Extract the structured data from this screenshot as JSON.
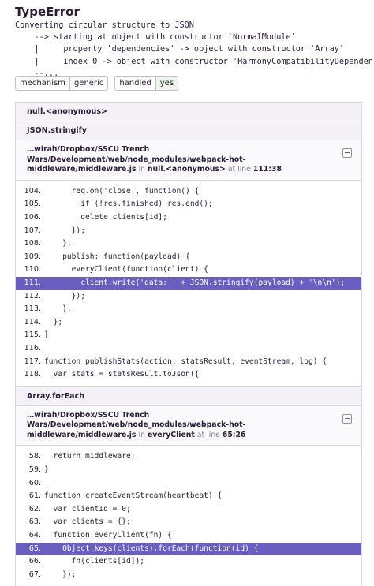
{
  "error": {
    "title": "TypeError",
    "message": "Converting circular structure to JSON\n    --> starting at object with constructor 'NormalModule'\n    |     property 'dependencies' -> object with constructor 'Array'\n    |     index 0 -> object with constructor 'HarmonyCompatibilityDependency'\n    --..."
  },
  "tags": [
    {
      "key": "mechanism",
      "value": "generic"
    },
    {
      "key": "handled",
      "value": "yes"
    }
  ],
  "frames": {
    "f1": {
      "name": "null.<anonymous>"
    },
    "f2": {
      "name": "JSON.stringify"
    },
    "f3": {
      "name": "Array.forEach",
      "path": "…wirah/Dropbox/SSCU Trench Wars/Development/web/node_modules/webpack-hot-middleware/middleware.js",
      "in_label": "in",
      "function": "null.<anonymous>",
      "at_label": "at line",
      "location": "111:38",
      "lines": [
        {
          "n": "104.",
          "code": "      req.on('close', function() {"
        },
        {
          "n": "105.",
          "code": "        if (!res.finished) res.end();"
        },
        {
          "n": "106.",
          "code": "        delete clients[id];"
        },
        {
          "n": "107.",
          "code": "      });"
        },
        {
          "n": "108.",
          "code": "    },"
        },
        {
          "n": "109.",
          "code": "    publish: function(payload) {"
        },
        {
          "n": "110.",
          "code": "      everyClient(function(client) {"
        },
        {
          "n": "111.",
          "code": "        client.write('data: ' + JSON.stringify(payload) + '\\n\\n');"
        },
        {
          "n": "112.",
          "code": "      });"
        },
        {
          "n": "113.",
          "code": "    },"
        },
        {
          "n": "114.",
          "code": "  };"
        },
        {
          "n": "115.",
          "code": "}"
        },
        {
          "n": "116.",
          "code": ""
        },
        {
          "n": "117.",
          "code": "function publishStats(action, statsResult, eventStream, log) {"
        },
        {
          "n": "118.",
          "code": "  var stats = statsResult.toJson({"
        }
      ]
    },
    "f4": {
      "path": "…wirah/Dropbox/SSCU Trench Wars/Development/web/node_modules/webpack-hot-middleware/middleware.js",
      "in_label": "in",
      "function": "everyClient",
      "at_label": "at line",
      "location": "65:26",
      "lines": [
        {
          "n": "58.",
          "code": "  return middleware;"
        },
        {
          "n": "59.",
          "code": "}"
        },
        {
          "n": "60.",
          "code": ""
        },
        {
          "n": "61.",
          "code": "function createEventStream(heartbeat) {"
        },
        {
          "n": "62.",
          "code": "  var clientId = 0;"
        },
        {
          "n": "63.",
          "code": "  var clients = {};"
        },
        {
          "n": "64.",
          "code": "  function everyClient(fn) {"
        },
        {
          "n": "65.",
          "code": "    Object.keys(clients).forEach(function(id) {"
        },
        {
          "n": "66.",
          "code": "      fn(clients[id]);"
        },
        {
          "n": "67.",
          "code": "    });"
        }
      ]
    }
  }
}
